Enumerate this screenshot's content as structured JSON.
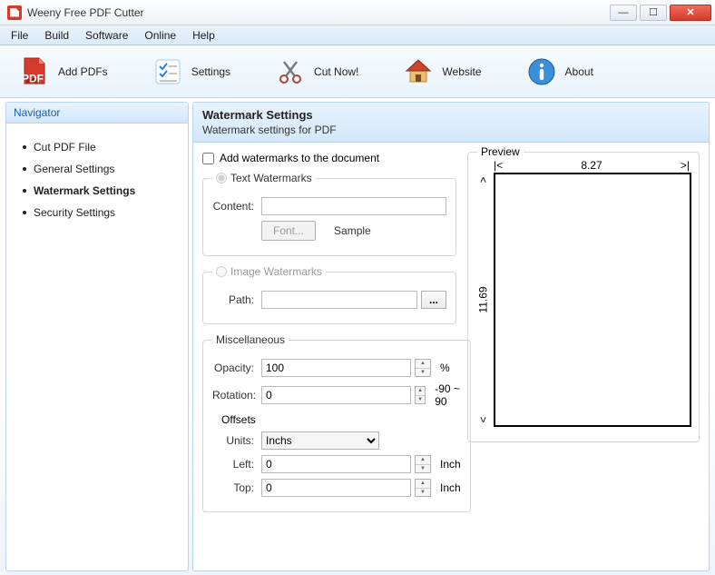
{
  "window": {
    "title": "Weeny Free PDF Cutter"
  },
  "menu": {
    "file": "File",
    "build": "Build",
    "software": "Software",
    "online": "Online",
    "help": "Help"
  },
  "toolbar": {
    "add_pdfs": "Add PDFs",
    "settings": "Settings",
    "cut_now": "Cut Now!",
    "website": "Website",
    "about": "About"
  },
  "navigator": {
    "title": "Navigator",
    "items": [
      "Cut PDF File",
      "General Settings",
      "Watermark Settings",
      "Security Settings"
    ],
    "active_index": 2
  },
  "panel": {
    "title": "Watermark Settings",
    "subtitle": "Watermark settings for PDF",
    "add_watermarks_label": "Add watermarks to the document",
    "add_watermarks_checked": false,
    "text_group": {
      "legend": "Text Watermarks",
      "selected": true,
      "content_label": "Content:",
      "content_value": "",
      "font_btn": "Font...",
      "sample_label": "Sample"
    },
    "image_group": {
      "legend": "Image Watermarks",
      "selected": false,
      "path_label": "Path:",
      "path_value": ""
    },
    "misc": {
      "legend": "Miscellaneous",
      "opacity_label": "Opacity:",
      "opacity_value": "100",
      "opacity_unit": "%",
      "rotation_label": "Rotation:",
      "rotation_value": "0",
      "rotation_range": "-90 ~ 90",
      "offsets_label": "Offsets",
      "units_label": "Units:",
      "units_value": "Inchs",
      "left_label": "Left:",
      "left_value": "0",
      "left_unit": "Inch",
      "top_label": "Top:",
      "top_value": "0",
      "top_unit": "Inch"
    },
    "preview": {
      "legend": "Preview",
      "width": "8.27",
      "height": "11.69"
    }
  }
}
